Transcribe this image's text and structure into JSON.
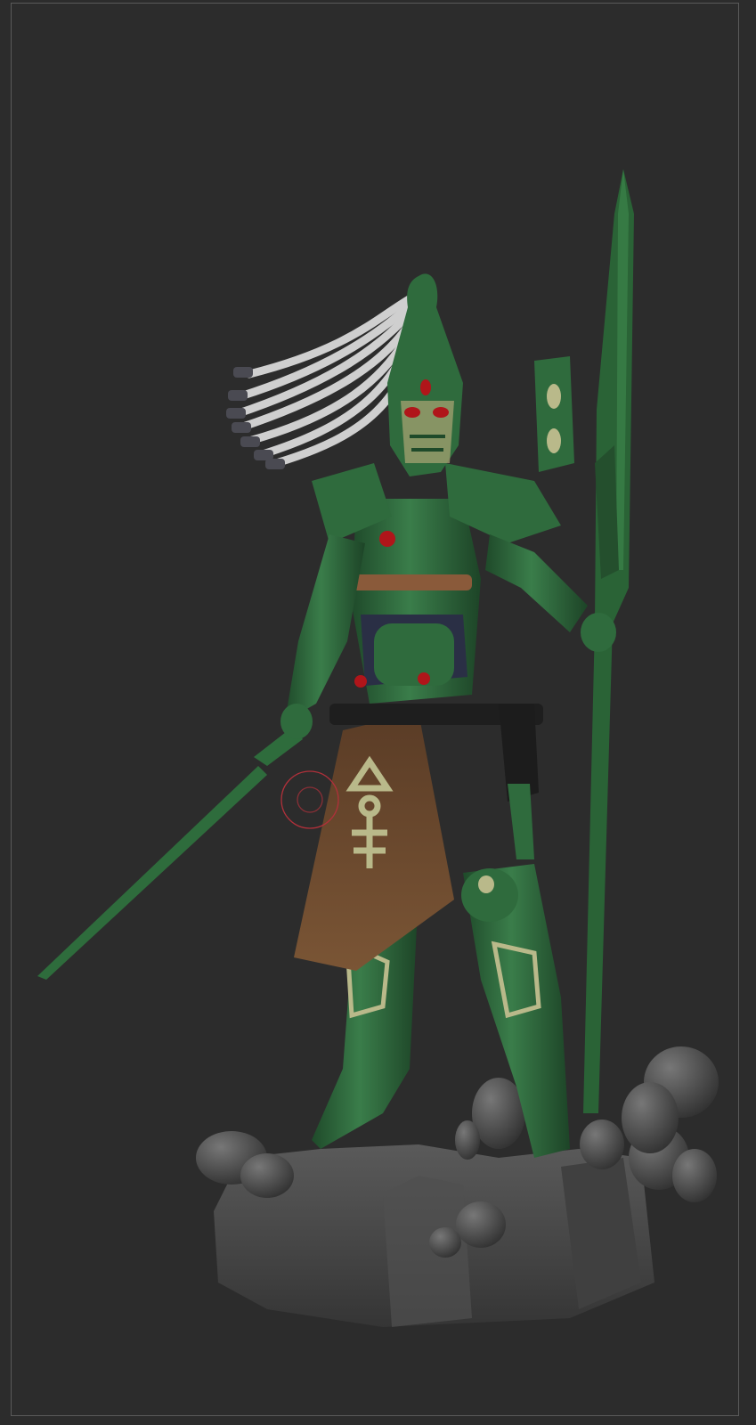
{
  "viewport": {
    "background": "#2c2c2c",
    "frame_color": "#5a5a5a"
  },
  "model": {
    "armor_color": "#2f6b3d",
    "armor_dark": "#1f4a2a",
    "trim_color": "#b9b98a",
    "gem_color": "#b0151a",
    "cloth_color": "#6b4a30",
    "hair_color": "#cfcfcf",
    "base_color": "#4a4a4a"
  },
  "cursor": {
    "icon": "brush-cursor-icon",
    "color": "#b0303a"
  }
}
